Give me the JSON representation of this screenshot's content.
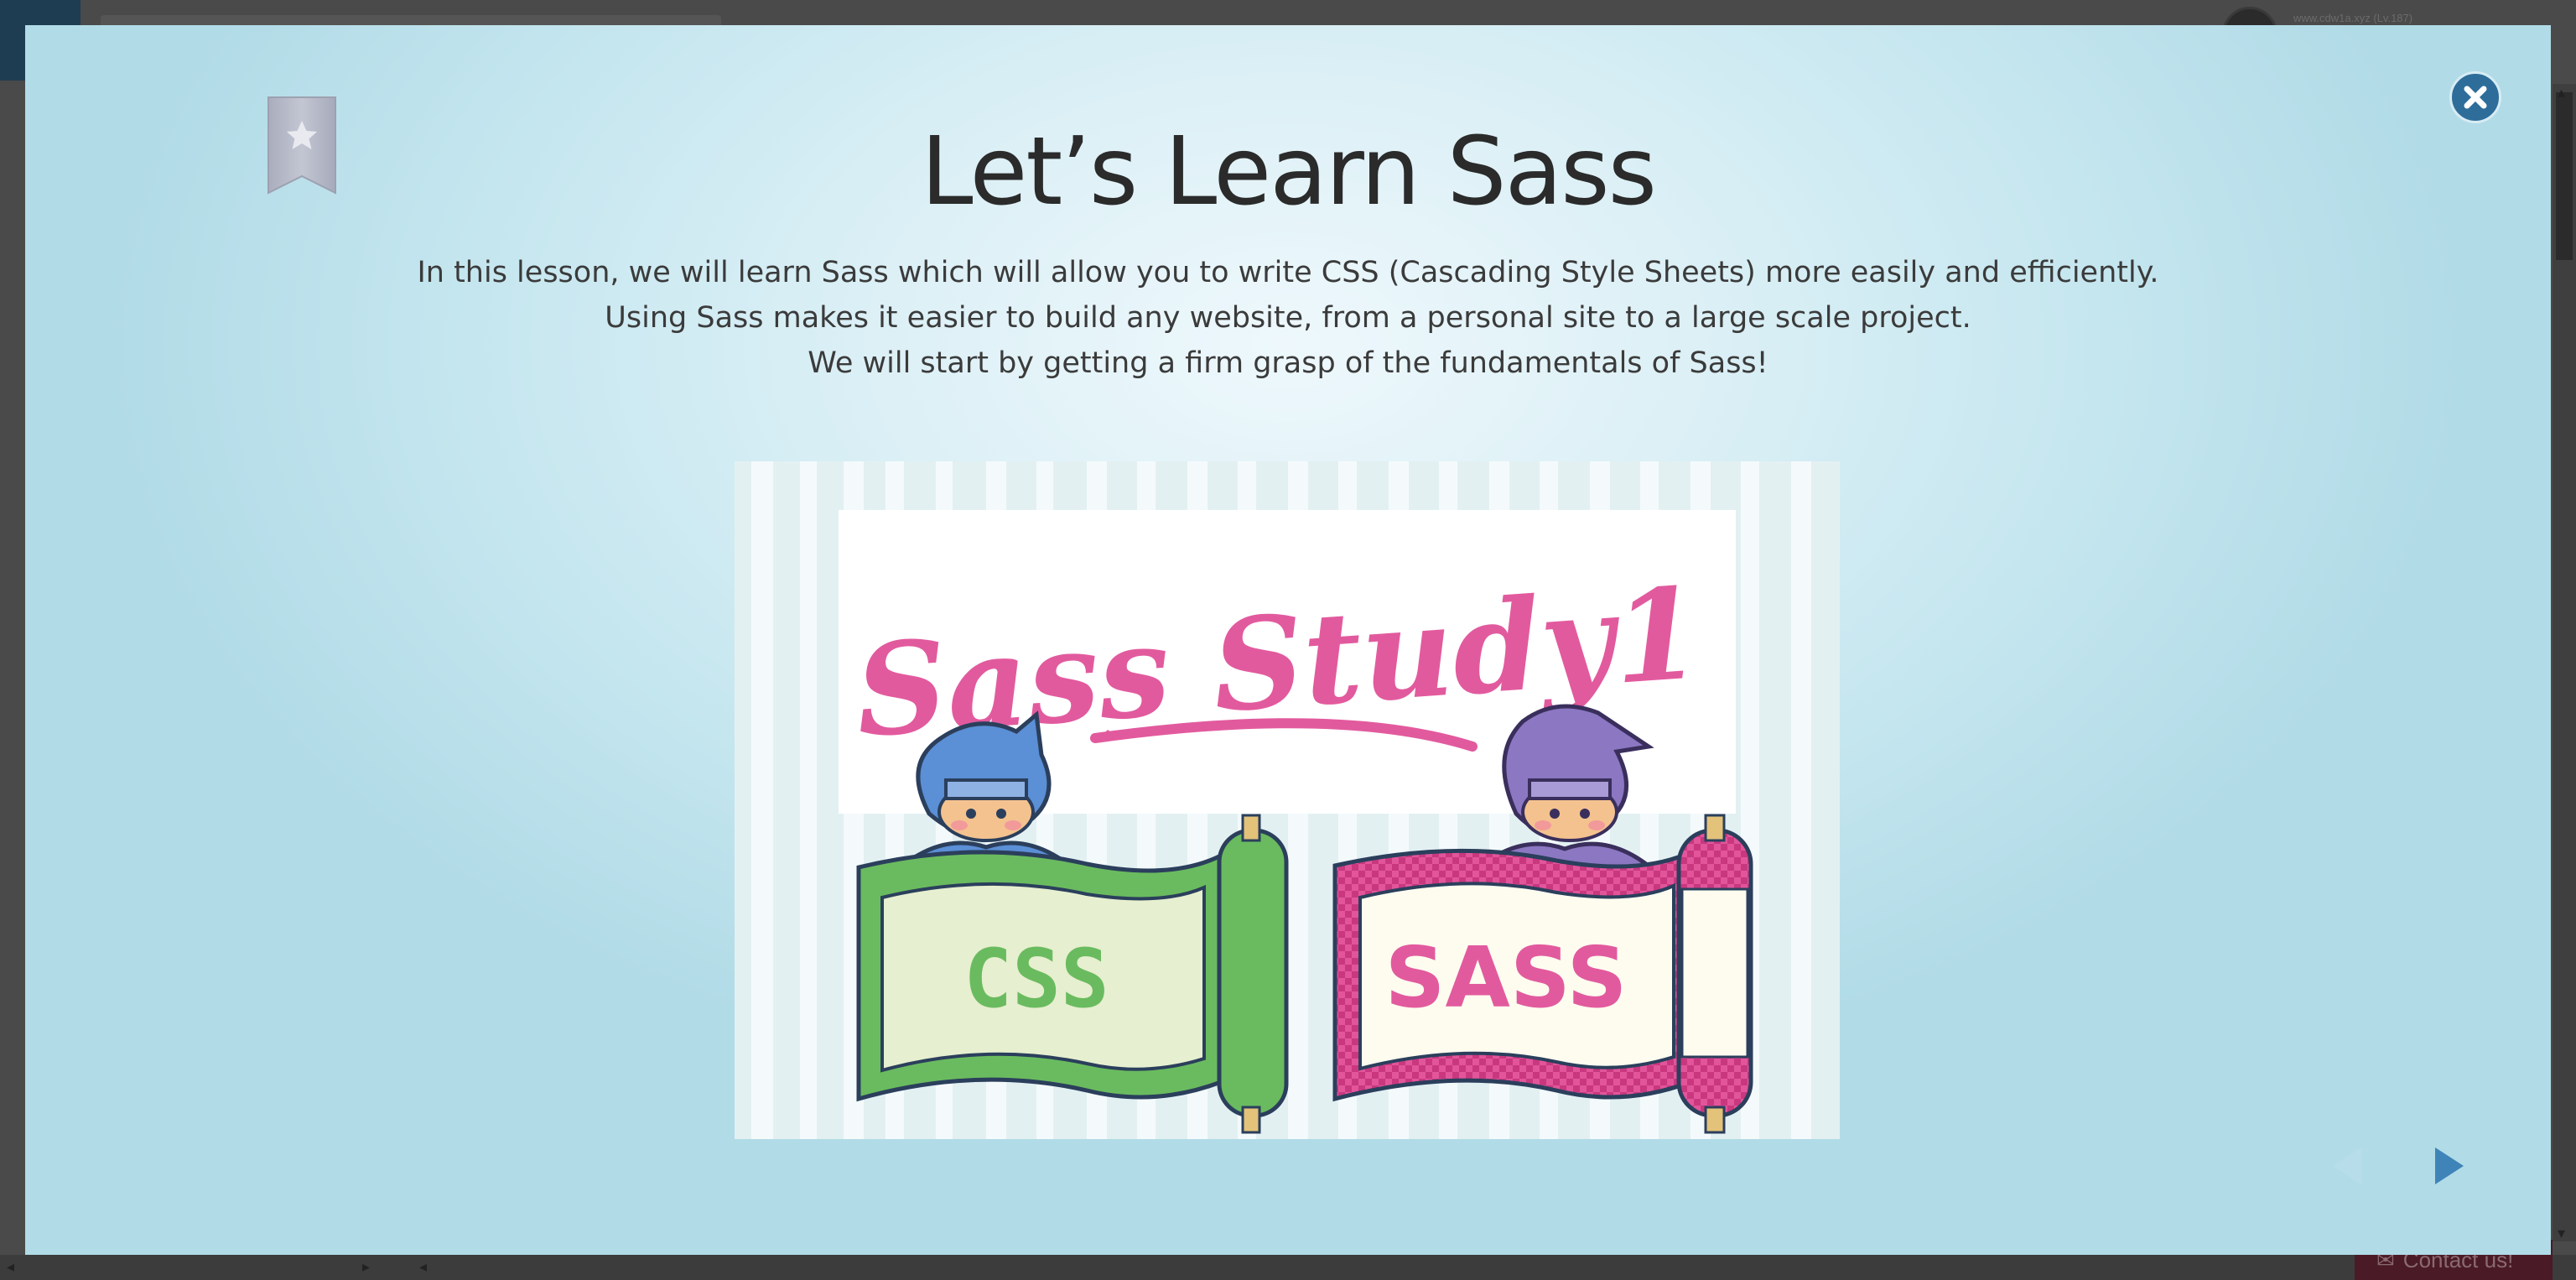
{
  "background": {
    "logo_glyph": "▤",
    "user_text": "www.cdw1a.xyz (Lv.187)",
    "contact_label": "Contact us!",
    "contact_icon": "mail-icon"
  },
  "modal": {
    "title": "Let’s Learn Sass",
    "description": [
      "In this lesson, we will learn Sass which will allow you to write CSS (Cascading Style Sheets) more easily and efficiently.",
      "Using Sass makes it easier to build any website, from a personal site to a large scale project.",
      "We will start by getting a firm grasp of the fundamentals of Sass!"
    ],
    "bookmark_icon": "star-bookmark-icon",
    "close_icon": "close-icon",
    "prev_icon": "triangle-left-icon",
    "next_icon": "triangle-right-icon",
    "illustration": {
      "heading": "Sass Study1",
      "scroll_left_text": "CSS",
      "scroll_right_text": "SASS"
    }
  },
  "colors": {
    "accent": "#2e6d9a",
    "sass_pink": "#e25a9e",
    "css_green": "#6abb5f"
  }
}
